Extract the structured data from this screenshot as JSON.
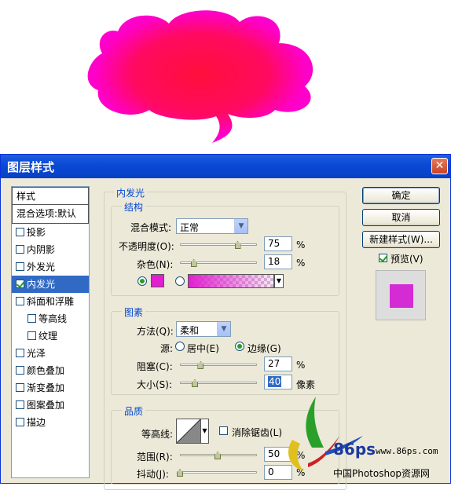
{
  "dialog": {
    "title": "图层样式",
    "close": "✕"
  },
  "left_list": {
    "header": "样式",
    "blend_options": "混合选项:默认",
    "items": [
      {
        "label": "投影",
        "checked": false,
        "sub": false,
        "selected": false
      },
      {
        "label": "内阴影",
        "checked": false,
        "sub": false,
        "selected": false
      },
      {
        "label": "外发光",
        "checked": false,
        "sub": false,
        "selected": false
      },
      {
        "label": "内发光",
        "checked": true,
        "sub": false,
        "selected": true
      },
      {
        "label": "斜面和浮雕",
        "checked": false,
        "sub": false,
        "selected": false
      },
      {
        "label": "等高线",
        "checked": false,
        "sub": true,
        "selected": false
      },
      {
        "label": "纹理",
        "checked": false,
        "sub": true,
        "selected": false
      },
      {
        "label": "光泽",
        "checked": false,
        "sub": false,
        "selected": false
      },
      {
        "label": "颜色叠加",
        "checked": false,
        "sub": false,
        "selected": false
      },
      {
        "label": "渐变叠加",
        "checked": false,
        "sub": false,
        "selected": false
      },
      {
        "label": "图案叠加",
        "checked": false,
        "sub": false,
        "selected": false
      },
      {
        "label": "描边",
        "checked": false,
        "sub": false,
        "selected": false
      }
    ]
  },
  "inner_glow": {
    "title": "内发光",
    "structure": {
      "title": "结构",
      "blend_mode_label": "混合模式:",
      "blend_mode_value": "正常",
      "opacity_label": "不透明度(O):",
      "opacity_value": "75",
      "opacity_unit": "%",
      "opacity_fraction": 0.75,
      "noise_label": "杂色(N):",
      "noise_value": "18",
      "noise_unit": "%",
      "noise_fraction": 0.18,
      "color": "#e020d0"
    },
    "elements": {
      "title": "图素",
      "method_label": "方法(Q):",
      "method_value": "柔和",
      "source_label": "源:",
      "source_center": "居中(E)",
      "source_edge": "边缘(G)",
      "choke_label": "阻塞(C):",
      "choke_value": "27",
      "choke_unit": "%",
      "choke_fraction": 0.27,
      "size_label": "大小(S):",
      "size_value": "40",
      "size_unit": "像素"
    },
    "quality": {
      "title": "品质",
      "contour_label": "等高线:",
      "anti_alias": "消除锯齿(L)",
      "range_label": "范围(R):",
      "range_value": "50",
      "range_unit": "%",
      "jitter_label": "抖动(J):",
      "jitter_value": "0",
      "jitter_unit": "%"
    }
  },
  "buttons": {
    "ok": "确定",
    "cancel": "取消",
    "new_style": "新建样式(W)...",
    "preview": "预览(V)"
  },
  "watermark": {
    "logo_text": "86ps",
    "url": "www.86ps.com",
    "site": "中国Photoshop资源网"
  },
  "colors": {
    "shape_fill": "#ff00cc",
    "glow": "#e0142c",
    "accent": "#0a4ad6"
  }
}
